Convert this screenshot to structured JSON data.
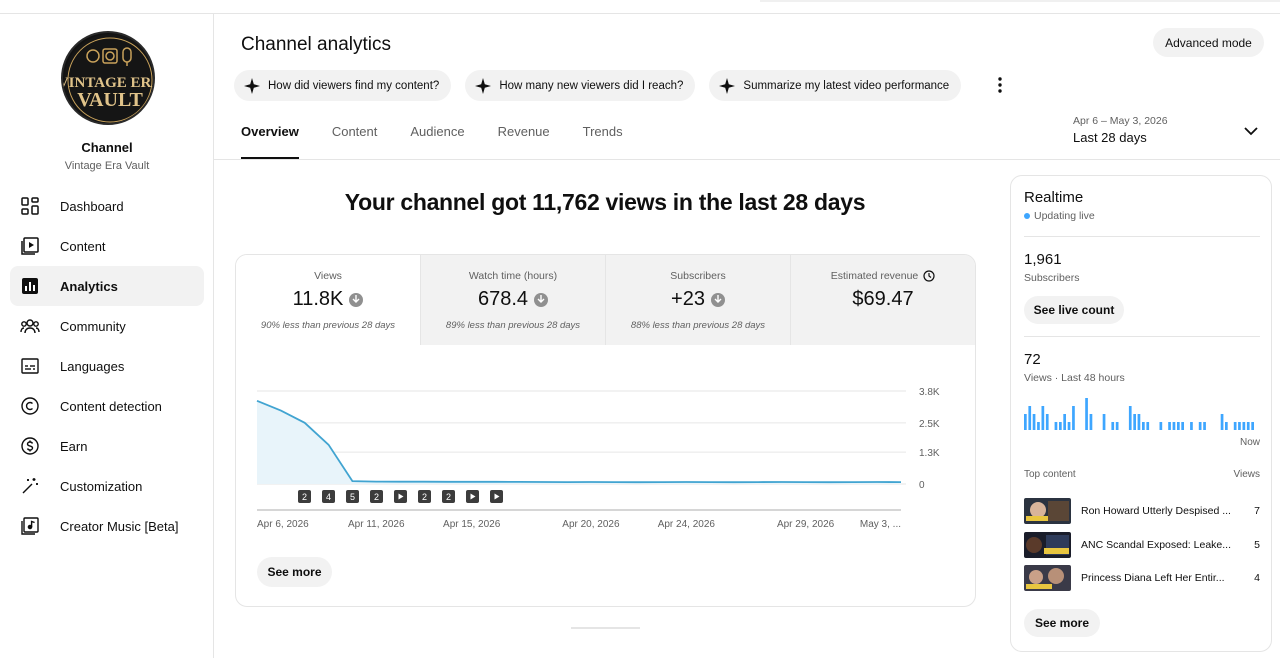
{
  "sidebar": {
    "logo_text_line1": "VINTAGE ERA",
    "logo_text_line2": "VAULT",
    "title": "Channel",
    "channel_name": "Vintage Era Vault",
    "items": [
      {
        "label": "Dashboard",
        "icon": "dashboard-icon"
      },
      {
        "label": "Content",
        "icon": "content-icon"
      },
      {
        "label": "Analytics",
        "icon": "analytics-icon",
        "active": true
      },
      {
        "label": "Community",
        "icon": "community-icon"
      },
      {
        "label": "Languages",
        "icon": "subtitles-icon"
      },
      {
        "label": "Content detection",
        "icon": "copyright-icon"
      },
      {
        "label": "Earn",
        "icon": "dollar-icon"
      },
      {
        "label": "Customization",
        "icon": "magic-wand-icon"
      },
      {
        "label": "Creator Music [Beta]",
        "icon": "music-icon"
      }
    ]
  },
  "header": {
    "title": "Channel analytics",
    "advanced_mode": "Advanced mode",
    "chips": [
      "How did viewers find my content?",
      "How many new viewers did I reach?",
      "Summarize my latest video performance"
    ],
    "tabs": [
      "Overview",
      "Content",
      "Audience",
      "Revenue",
      "Trends"
    ],
    "active_tab": "Overview",
    "date_range": "Apr 6 – May 3, 2026",
    "date_label": "Last 28 days"
  },
  "main": {
    "headline": "Your channel got 11,762 views in the last 28 days",
    "metrics": [
      {
        "label": "Views",
        "value": "11.8K",
        "note": "90% less than previous 28 days",
        "trend": "down"
      },
      {
        "label": "Watch time (hours)",
        "value": "678.4",
        "note": "89% less than previous 28 days",
        "trend": "down"
      },
      {
        "label": "Subscribers",
        "value": "+23",
        "note": "88% less than previous 28 days",
        "trend": "down"
      },
      {
        "label": "Estimated revenue",
        "value": "$69.47",
        "note": "",
        "trend": "info"
      }
    ],
    "see_more": "See more"
  },
  "chart_data": {
    "type": "area",
    "series": [
      {
        "values": [
          3400,
          3000,
          2500,
          1600,
          120,
          100,
          95,
          95,
          90,
          88,
          90,
          85,
          80,
          78,
          80,
          78,
          75,
          78,
          80,
          78,
          75,
          78,
          80,
          78,
          75,
          78,
          80,
          78
        ]
      }
    ],
    "x_count": 28,
    "x_tick_labels": [
      "Apr 6, 2026",
      "Apr 11, 2026",
      "Apr 15, 2026",
      "Apr 20, 2026",
      "Apr 24, 2026",
      "Apr 29, 2026",
      "May 3, ..."
    ],
    "x_tick_index": [
      0,
      5,
      9,
      14,
      18,
      23,
      27
    ],
    "y_tick_labels": [
      "3.8K",
      "2.5K",
      "1.3K",
      "0"
    ],
    "y_tick_values": [
      3800,
      2500,
      1300,
      0
    ],
    "ylim": [
      0,
      3800
    ],
    "upload_markers": [
      {
        "label": "2",
        "type": "count"
      },
      {
        "label": "4",
        "type": "count"
      },
      {
        "label": "5",
        "type": "count"
      },
      {
        "label": "2",
        "type": "count"
      },
      {
        "label": "",
        "type": "video"
      },
      {
        "label": "2",
        "type": "count"
      },
      {
        "label": "2",
        "type": "count"
      },
      {
        "label": "",
        "type": "video"
      },
      {
        "label": "",
        "type": "video"
      }
    ],
    "colors": {
      "line": "#41a4d1",
      "fill": "#e8f4fa",
      "grid": "#e6e6e6"
    }
  },
  "realtime": {
    "title": "Realtime",
    "status": "Updating live",
    "subscribers_count": "1,961",
    "subscribers_label": "Subscribers",
    "see_live_count": "See live count",
    "views_count": "72",
    "views_label": "Views · Last 48 hours",
    "bars": [
      2,
      3,
      2,
      1,
      3,
      2,
      0,
      1,
      1,
      2,
      1,
      3,
      0,
      0,
      4,
      2,
      0,
      0,
      2,
      0,
      1,
      1,
      0,
      0,
      3,
      2,
      2,
      1,
      1,
      0,
      0,
      1,
      0,
      1,
      1,
      1,
      1,
      0,
      1,
      0,
      1,
      1,
      0,
      0,
      0,
      2,
      1,
      0,
      1,
      1,
      1,
      1,
      1,
      0
    ],
    "now_label": "Now",
    "top_content_label": "Top content",
    "views_col_label": "Views",
    "top_content": [
      {
        "title": "Ron Howard Utterly Despised ...",
        "views": "7"
      },
      {
        "title": "ANC Scandal Exposed: Leake...",
        "views": "5"
      },
      {
        "title": "Princess Diana Left Her Entir...",
        "views": "4"
      }
    ],
    "see_more": "See more",
    "accent": "#3ea6ff"
  }
}
